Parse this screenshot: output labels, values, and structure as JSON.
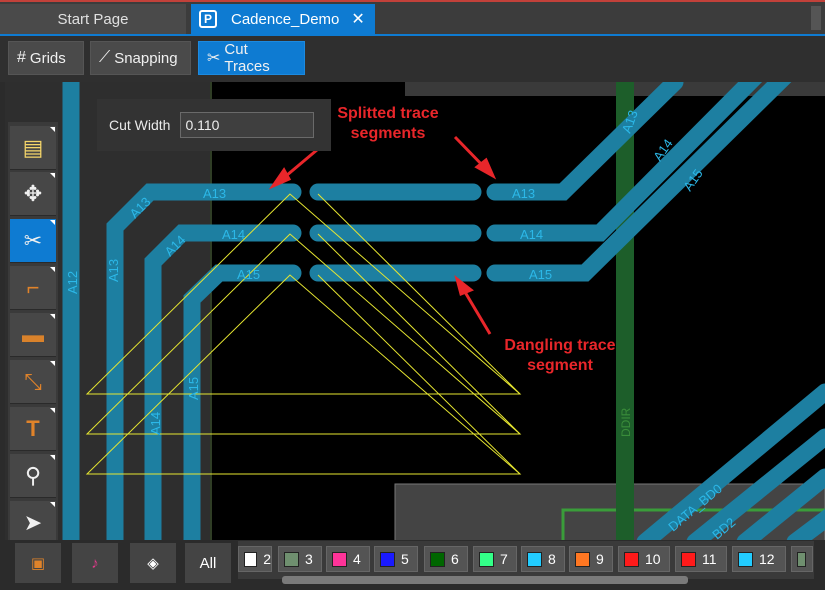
{
  "tabs": [
    {
      "label": "Start Page"
    },
    {
      "label": "Cadence_Demo"
    }
  ],
  "toolbar": {
    "grids": "Grids",
    "snapping": "Snapping",
    "cut_traces": "Cut Traces"
  },
  "cut_panel": {
    "label": "Cut Width",
    "value": "0.110"
  },
  "annotations": {
    "split_line1": "Splitted  trace",
    "split_line2": "segments",
    "dangling_line1": "Dangling trace",
    "dangling_line2": "segment"
  },
  "trace_labels": {
    "a13": "A13",
    "a14": "A14",
    "a15": "A15",
    "a12": "A12",
    "ddir": "DDIR",
    "data_bd0": "DATA_BD0",
    "bd2": "BD2"
  },
  "left_tools": [
    {
      "name": "comment-icon"
    },
    {
      "name": "move-icon"
    },
    {
      "name": "scissors-icon"
    },
    {
      "name": "route-icon"
    },
    {
      "name": "add-area-icon"
    },
    {
      "name": "connect-icon"
    },
    {
      "name": "add-text-icon"
    },
    {
      "name": "zoom-icon"
    },
    {
      "name": "pointer-icon"
    }
  ],
  "bottom": {
    "all_label": "All"
  },
  "layers": [
    {
      "num": "2",
      "color": "#ffffff"
    },
    {
      "num": "3",
      "color": "#6f8f6f"
    },
    {
      "num": "4",
      "color": "#ff3399"
    },
    {
      "num": "5",
      "color": "#1a1aff"
    },
    {
      "num": "6",
      "color": "#006600"
    },
    {
      "num": "7",
      "color": "#33ff88"
    },
    {
      "num": "8",
      "color": "#22ccff"
    },
    {
      "num": "9",
      "color": "#ff7722"
    },
    {
      "num": "10",
      "color": "#ff1a1a"
    },
    {
      "num": "11",
      "color": "#ff1a1a"
    },
    {
      "num": "12",
      "color": "#22ccff"
    }
  ],
  "colors": {
    "accent": "#0e7bd2",
    "trace": "#1d7fa1",
    "annotation": "#e8262a"
  }
}
